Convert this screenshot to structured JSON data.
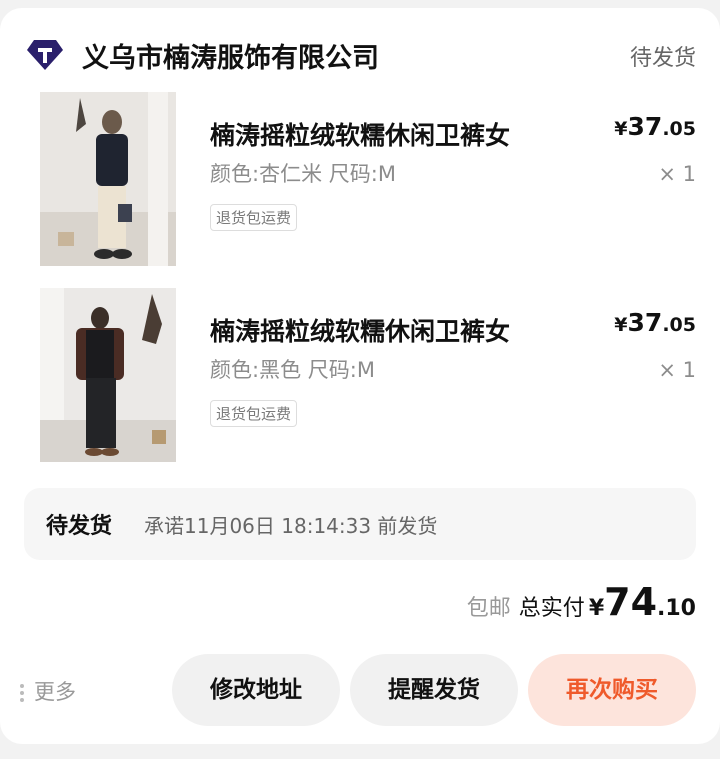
{
  "shop": {
    "name": "义乌市楠涛服饰有限公司",
    "status": "待发货",
    "logo_icon": "diamond-shop-icon",
    "logo_color": "#2a1f6b"
  },
  "items": [
    {
      "title": "楠涛摇粒绒软糯休闲卫裤女",
      "spec": "颜色:杏仁米 尺码:M",
      "tag": "退货包运费",
      "price_symbol": "¥",
      "price_int": "37",
      "price_dec": ".05",
      "qty": "× 1"
    },
    {
      "title": "楠涛摇粒绒软糯休闲卫裤女",
      "spec": "颜色:黑色 尺码:M",
      "tag": "退货包运费",
      "price_symbol": "¥",
      "price_int": "37",
      "price_dec": ".05",
      "qty": "× 1"
    }
  ],
  "shipping": {
    "label": "待发货",
    "promise": "承诺11月06日 18:14:33 前发货"
  },
  "total": {
    "free_shipping": "包邮",
    "label": "总实付",
    "symbol": "¥",
    "int": "74",
    "dec": ".10"
  },
  "actions": {
    "more": "更多",
    "change_address": "修改地址",
    "remind_ship": "提醒发货",
    "buy_again": "再次购买"
  },
  "colors": {
    "accent": "#ef5a2b",
    "accent_bg": "#fde4dc"
  }
}
